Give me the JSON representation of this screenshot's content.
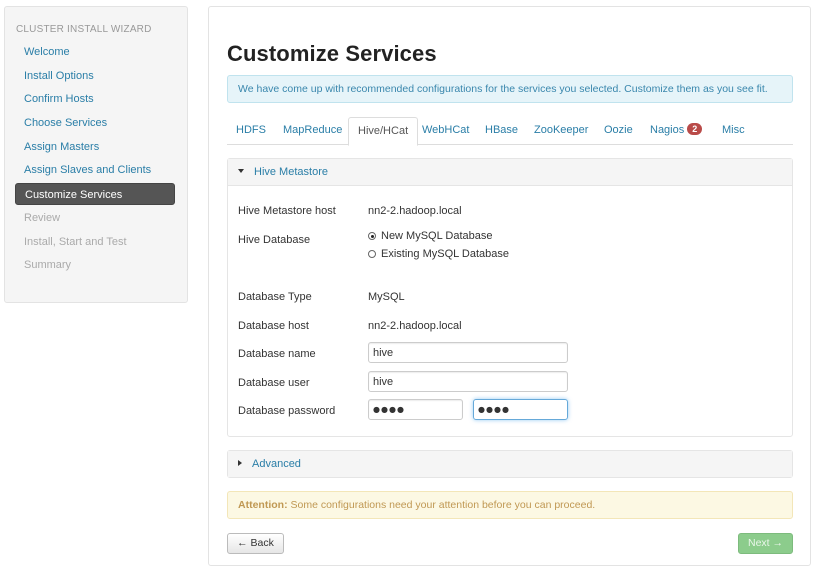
{
  "sidebar": {
    "header": "CLUSTER INSTALL WIZARD",
    "items": [
      {
        "label": "Welcome",
        "state": "done"
      },
      {
        "label": "Install Options",
        "state": "done"
      },
      {
        "label": "Confirm Hosts",
        "state": "done"
      },
      {
        "label": "Choose Services",
        "state": "done"
      },
      {
        "label": "Assign Masters",
        "state": "done"
      },
      {
        "label": "Assign Slaves and Clients",
        "state": "done"
      },
      {
        "label": "Customize Services",
        "state": "active"
      },
      {
        "label": "Review",
        "state": "disabled"
      },
      {
        "label": "Install, Start and Test",
        "state": "disabled"
      },
      {
        "label": "Summary",
        "state": "disabled"
      }
    ]
  },
  "main": {
    "title": "Customize Services",
    "info": "We have come up with recommended configurations for the services you selected. Customize them as you see fit.",
    "tabs": [
      {
        "label": "HDFS"
      },
      {
        "label": "MapReduce"
      },
      {
        "label": "Hive/HCat",
        "active": true
      },
      {
        "label": "WebHCat"
      },
      {
        "label": "HBase"
      },
      {
        "label": "ZooKeeper"
      },
      {
        "label": "Oozie"
      },
      {
        "label": "Nagios",
        "badge": "2"
      },
      {
        "label": "Misc"
      }
    ],
    "hive_metastore": {
      "header": "Hive Metastore",
      "host_label": "Hive Metastore host",
      "host_value": "nn2-2.hadoop.local",
      "db_label": "Hive Database",
      "db_options": [
        {
          "label": "New MySQL Database",
          "checked": true
        },
        {
          "label": "Existing MySQL Database",
          "checked": false
        }
      ],
      "db_type_label": "Database Type",
      "db_type_value": "MySQL",
      "db_host_label": "Database host",
      "db_host_value": "nn2-2.hadoop.local",
      "db_name_label": "Database name",
      "db_name_value": "hive",
      "db_user_label": "Database user",
      "db_user_value": "hive",
      "db_password_label": "Database password",
      "db_password_mask": "●●●●",
      "db_password_confirm_mask": "●●●●"
    },
    "advanced": {
      "header": "Advanced"
    },
    "attention": {
      "strong": "Attention:",
      "text": " Some configurations need your attention before you can proceed."
    },
    "back_label": "← Back",
    "next_label": "Next →"
  },
  "colors": {
    "link": "#2a7ea7",
    "active_nav": "#555555",
    "badge": "#b94a48",
    "next_button": "#8ccc8c"
  }
}
